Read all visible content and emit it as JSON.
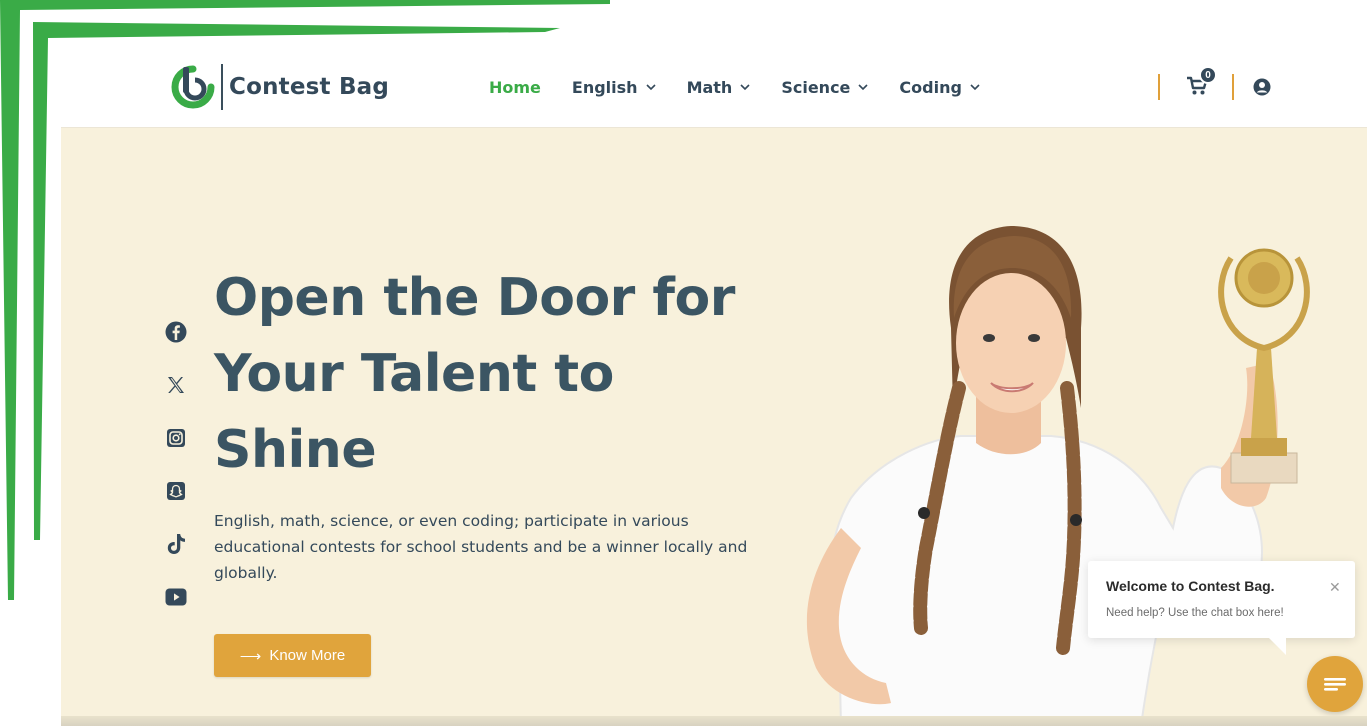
{
  "brand": {
    "name": "Contest Bag",
    "accent": "#3aab47",
    "dark": "#34495a",
    "gold": "#e0a43c",
    "cream": "#f8f1dc"
  },
  "nav": {
    "items": [
      {
        "label": "Home",
        "active": true
      },
      {
        "label": "English"
      },
      {
        "label": "Math"
      },
      {
        "label": "Science"
      },
      {
        "label": "Coding"
      }
    ]
  },
  "header": {
    "cart_count": "0",
    "cart_icon": "cart-icon",
    "user_icon": "user-circle-icon"
  },
  "social": [
    "facebook-icon",
    "x-icon",
    "instagram-icon",
    "snapchat-icon",
    "tiktok-icon",
    "youtube-icon"
  ],
  "hero": {
    "title_lines": [
      "Open the Door for",
      "Your Talent to",
      "Shine"
    ],
    "text": "English, math, science, or even coding; participate in various educational contests for school students and be a winner locally and globally.",
    "cta_label": "Know More"
  },
  "chat": {
    "title": "Welcome to Contest Bag.",
    "subtitle": "Need help? Use the chat box here!",
    "close": "✕"
  }
}
